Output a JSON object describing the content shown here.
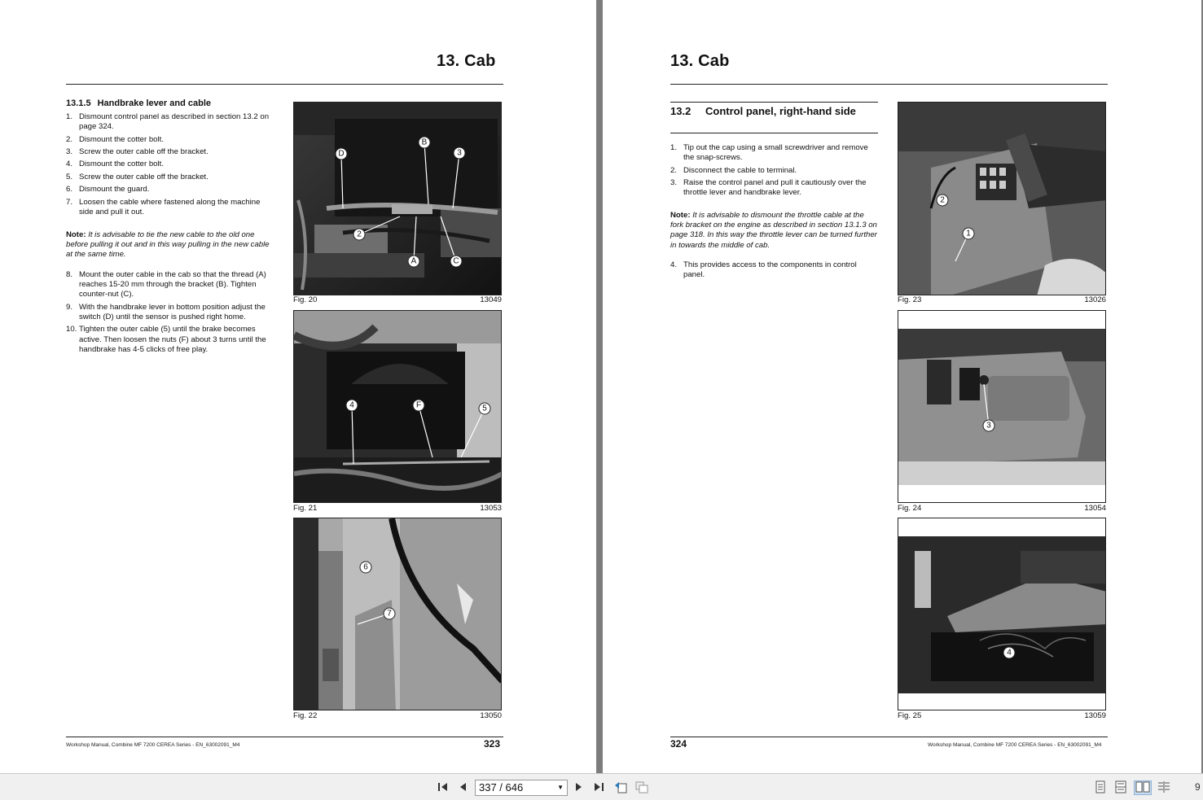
{
  "left_page": {
    "chapter": "13. Cab",
    "section_number": "13.1.5",
    "section_title": "Handbrake lever and cable",
    "steps_a": [
      {
        "n": "1.",
        "text": "Dismount control panel as described in section 13.2 on page 324."
      },
      {
        "n": "2.",
        "text": "Dismount the cotter bolt."
      },
      {
        "n": "3.",
        "text": "Screw the outer cable off the bracket."
      },
      {
        "n": "4.",
        "text": "Dismount the cotter bolt."
      },
      {
        "n": "5.",
        "text": "Screw the outer cable off the bracket."
      },
      {
        "n": "6.",
        "text": "Dismount the guard."
      },
      {
        "n": "7.",
        "text": "Loosen the cable where fastened along the machine side and pull it out."
      }
    ],
    "note_label": "Note:",
    "note_text": "It is advisable to tie the new cable to the old one before pulling it out and in this way pulling in the new cable at the same time.",
    "steps_b": [
      {
        "n": "8.",
        "text": "Mount the outer cable in the cab so that the thread (A) reaches 15-20 mm through the bracket (B). Tighten counter-nut (C)."
      },
      {
        "n": "9.",
        "text": "With the handbrake lever in bottom position adjust the switch (D) until the sensor is pushed right home."
      },
      {
        "n": "10.",
        "text": "Tighten the outer cable (5) until the brake becomes active. Then loosen the nuts (F) about 3 turns until the handbrake has 4-5 clicks of free play."
      }
    ],
    "figures": [
      {
        "label": "Fig. 20",
        "code": "13049",
        "callouts": [
          "D",
          "B",
          "3",
          "2",
          "A",
          "C"
        ]
      },
      {
        "label": "Fig. 21",
        "code": "13053",
        "callouts": [
          "4",
          "F",
          "5"
        ]
      },
      {
        "label": "Fig. 22",
        "code": "13050",
        "callouts": [
          "6",
          "7"
        ]
      }
    ],
    "footer": "Workshop Manual, Combine MF 7200 CEREA Series - EN_63002091_M4",
    "page_number": "323"
  },
  "right_page": {
    "chapter": "13. Cab",
    "section_number": "13.2",
    "section_title": "Control panel, right-hand side",
    "steps_a": [
      {
        "n": "1.",
        "text": "Tip out the cap using a small screwdriver and remove the snap-screws."
      },
      {
        "n": "2.",
        "text": "Disconnect the cable to terminal."
      },
      {
        "n": "3.",
        "text": "Raise the control panel and pull it cautiously over the throttle lever and handbrake lever."
      }
    ],
    "note_label": "Note:",
    "note_text": "It is advisable to dismount the throttle cable at the fork bracket on the engine as described in section 13.1.3 on page 318. In this way the throttle lever can be turned further in towards the middle of cab.",
    "steps_b": [
      {
        "n": "4.",
        "text": "This provides access to the components in control panel."
      }
    ],
    "figures": [
      {
        "label": "Fig. 23",
        "code": "13026",
        "callouts": [
          "2",
          "1"
        ]
      },
      {
        "label": "Fig. 24",
        "code": "13054",
        "callouts": [
          "3"
        ]
      },
      {
        "label": "Fig. 25",
        "code": "13059",
        "callouts": [
          "4"
        ]
      }
    ],
    "footer": "Workshop Manual, Combine MF 7200 CEREA Series - EN_63002091_M4",
    "page_number": "324"
  },
  "toolbar": {
    "page_indicator": "337 / 646",
    "zoom_fragment": "9",
    "icons": [
      "first-page-icon",
      "prev-page-icon",
      "next-page-icon",
      "last-page-icon",
      "back-view-icon",
      "forward-view-icon",
      "single-page-icon",
      "continuous-icon",
      "two-page-icon",
      "two-page-continuous-icon"
    ]
  }
}
